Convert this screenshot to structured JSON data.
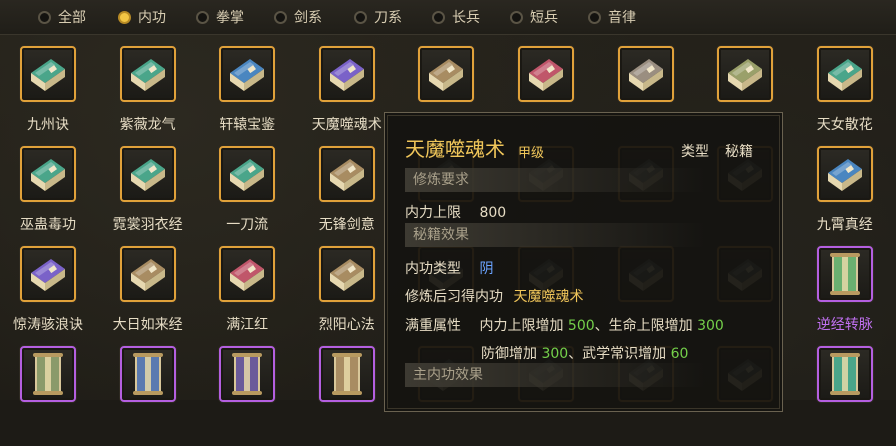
{
  "filters": [
    {
      "label": "全部",
      "selected": false
    },
    {
      "label": "内功",
      "selected": true
    },
    {
      "label": "拳掌",
      "selected": false
    },
    {
      "label": "剑系",
      "selected": false
    },
    {
      "label": "刀系",
      "selected": false
    },
    {
      "label": "长兵",
      "selected": false
    },
    {
      "label": "短兵",
      "selected": false
    },
    {
      "label": "音律",
      "selected": false
    }
  ],
  "grid": [
    {
      "name": "九州诀",
      "book_color": "#4aa58a",
      "frame": "orange"
    },
    {
      "name": "紫薇龙气",
      "book_color": "#4aa58a",
      "frame": "orange"
    },
    {
      "name": "轩辕宝鉴",
      "book_color": "#4a86c0",
      "frame": "orange"
    },
    {
      "name": "天魔噬魂术",
      "book_color": "#7a62c8",
      "frame": "orange"
    },
    {
      "name": "",
      "book_color": "#a88c62",
      "frame": "orange"
    },
    {
      "name": "",
      "book_color": "#c0566a",
      "frame": "orange"
    },
    {
      "name": "",
      "book_color": "#9a8e80",
      "frame": "orange"
    },
    {
      "name": "",
      "book_color": "#9aa06a",
      "frame": "orange"
    },
    {
      "name": "天女散花",
      "book_color": "#4aa58a",
      "frame": "orange"
    },
    {
      "name": "巫蛊毒功",
      "book_color": "#4aa58a",
      "frame": "orange"
    },
    {
      "name": "霓裳羽衣经",
      "book_color": "#4aa58a",
      "frame": "orange"
    },
    {
      "name": "一刀流",
      "book_color": "#4aa58a",
      "frame": "orange"
    },
    {
      "name": "无锋剑意",
      "book_color": "#a88c62",
      "frame": "orange"
    },
    {
      "name": "",
      "book_color": "#5a6a60",
      "frame": "orange"
    },
    {
      "name": "",
      "book_color": "#5a6a60",
      "frame": "orange"
    },
    {
      "name": "",
      "book_color": "#5a6a60",
      "frame": "orange"
    },
    {
      "name": "",
      "book_color": "#5a6a60",
      "frame": "orange"
    },
    {
      "name": "九霄真经",
      "book_color": "#4a86c0",
      "frame": "orange"
    },
    {
      "name": "惊涛骇浪诀",
      "book_color": "#7a62c8",
      "frame": "orange"
    },
    {
      "name": "大日如来经",
      "book_color": "#a88c62",
      "frame": "orange"
    },
    {
      "name": "满江红",
      "book_color": "#c0566a",
      "frame": "orange"
    },
    {
      "name": "烈阳心法",
      "book_color": "#a88c62",
      "frame": "orange"
    },
    {
      "name": "",
      "book_color": "#5a6a60",
      "frame": "orange"
    },
    {
      "name": "",
      "book_color": "#5a6a60",
      "frame": "orange"
    },
    {
      "name": "",
      "book_color": "#5a6a60",
      "frame": "orange"
    },
    {
      "name": "",
      "book_color": "#5a6a60",
      "frame": "orange"
    },
    {
      "name": "逆经转脉",
      "book_color": "#6ab070",
      "frame": "purple"
    },
    {
      "name": "",
      "book_color": "#8a9a6a",
      "frame": "purple"
    },
    {
      "name": "",
      "book_color": "#5a7ab0",
      "frame": "purple"
    },
    {
      "name": "",
      "book_color": "#6a5a9a",
      "frame": "purple"
    },
    {
      "name": "",
      "book_color": "#a88c62",
      "frame": "purple"
    },
    {
      "name": "",
      "book_color": "#5a6a60",
      "frame": "orange"
    },
    {
      "name": "",
      "book_color": "#5a6a60",
      "frame": "orange"
    },
    {
      "name": "",
      "book_color": "#5a6a60",
      "frame": "orange"
    },
    {
      "name": "",
      "book_color": "#5a6a60",
      "frame": "orange"
    },
    {
      "name": "",
      "book_color": "#4aa58a",
      "frame": "purple"
    }
  ],
  "tooltip": {
    "title": "天魔噬魂术",
    "grade": "甲级",
    "type_label": "类型",
    "type_value": "秘籍",
    "section_requirements": "修炼要求",
    "req_label": "内力上限",
    "req_value": "800",
    "section_effects": "秘籍效果",
    "neigong_type_label": "内功类型",
    "neigong_type_value": "阴",
    "learn_label": "修炼后习得内功",
    "learn_value": "天魔噬魂术",
    "full_label": "满重属性",
    "attr1_name": "内力上限增加",
    "attr1_val": "500",
    "attr2_name": "、生命上限增加",
    "attr2_val": "300",
    "attr3_name": "防御增加",
    "attr3_val": "300",
    "attr4_name": "、武学常识增加",
    "attr4_val": "60",
    "section_main": "主内功效果"
  }
}
